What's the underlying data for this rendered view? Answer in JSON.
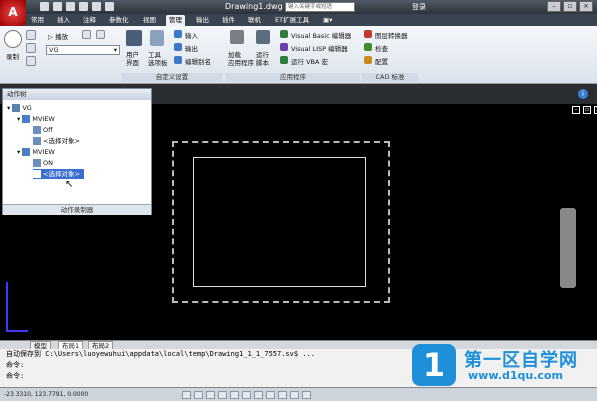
{
  "window": {
    "title": "Drawing1.dwg",
    "search_placeholder": "键入关键字或短语",
    "login": "登录"
  },
  "app_menu": {
    "label": "A"
  },
  "tabs": [
    "常用",
    "插入",
    "注释",
    "参数化",
    "视图",
    "管理",
    "输出",
    "插件",
    "联机",
    "ET扩展工具",
    "▣▾"
  ],
  "active_tab": "管理",
  "ribbon": {
    "record_label": "录制",
    "play_label": "播放",
    "vg_value": "VG",
    "user_interface": "用户\n界面",
    "tool_palette": "工具\n选项板",
    "import_label": "输入",
    "export_label": "输出",
    "rename": "编辑别名",
    "customize_panel": "自定义设置",
    "load_app": "加载\n应用程序",
    "run_script": "运行\n脚本",
    "vb_editor": "Visual Basic 编辑器",
    "vlisp_editor": "Visual LISP 编辑器",
    "run_vba": "运行 VBA 宏",
    "apps_panel": "应用程序",
    "layer_translator": "图层转换器",
    "check": "检查",
    "configure": "配置",
    "cad_standards_panel": "CAD 标准"
  },
  "action_tree": {
    "title": "动作树",
    "root": "VG",
    "node1": "MVIEW",
    "node1_child1": "Off",
    "node1_child2": "<选择对象>",
    "node2": "MVIEW",
    "node2_child1": "ON",
    "node2_child2": "<选择对象>",
    "footer": "动作录制器"
  },
  "layout_tabs": [
    "模型",
    "布局1",
    "布局2"
  ],
  "command_lines": [
    "自动保存到 C:\\Users\\luoyewuhui\\appdata\\local\\temp\\Drawing1_1_1_7557.sv$ ...",
    "命令:",
    "命令:"
  ],
  "status": {
    "coords": "-23.3310, 123.7791, 0.0000"
  },
  "watermark": {
    "logo": "1",
    "cn": "第一区自学网",
    "url": "www.d1qu.com"
  }
}
